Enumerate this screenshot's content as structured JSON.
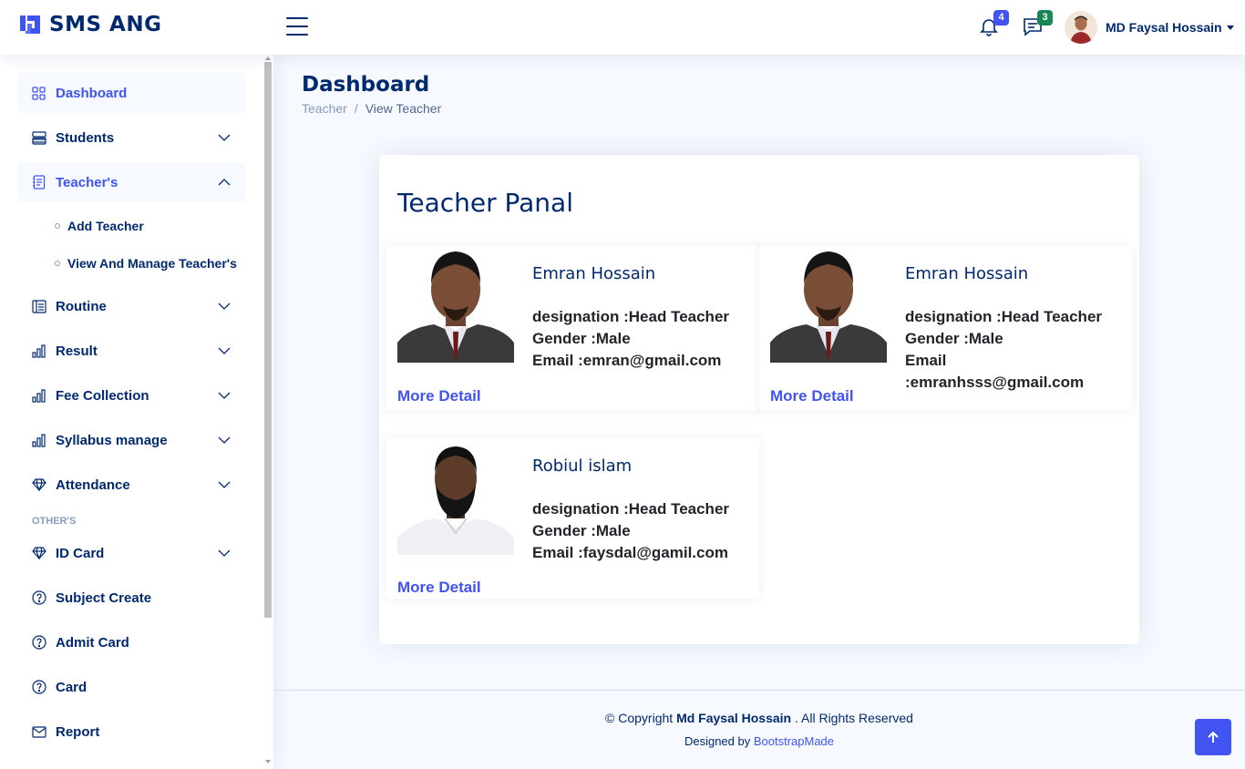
{
  "header": {
    "logo_text": "SMS ANG",
    "notifications_count": "4",
    "messages_count": "3",
    "profile_name": "MD Faysal Hossain"
  },
  "sidebar": {
    "items": [
      {
        "label": "Dashboard",
        "icon": "grid-icon"
      },
      {
        "label": "Students",
        "icon": "menu-button-icon"
      },
      {
        "label": "Teacher's",
        "icon": "journal-text-icon"
      },
      {
        "label": "Routine",
        "icon": "layout-text-icon"
      },
      {
        "label": "Result",
        "icon": "bar-chart-icon"
      },
      {
        "label": "Fee Collection",
        "icon": "bar-chart-icon"
      },
      {
        "label": "Syllabus manage",
        "icon": "bar-chart-icon"
      },
      {
        "label": "Attendance",
        "icon": "gem-icon"
      },
      {
        "label": "ID Card",
        "icon": "gem-icon"
      },
      {
        "label": "Subject Create",
        "icon": "question-circle-icon"
      },
      {
        "label": "Admit Card",
        "icon": "question-circle-icon"
      },
      {
        "label": "Card",
        "icon": "question-circle-icon"
      },
      {
        "label": "Report",
        "icon": "envelope-icon"
      }
    ],
    "sub_items": [
      "Add Teacher",
      "View And Manage Teacher's"
    ],
    "heading_others": "OTHER'S"
  },
  "page": {
    "title": "Dashboard",
    "breadcrumb": [
      "Teacher",
      "View Teacher"
    ]
  },
  "panel": {
    "title": "Teacher Panal",
    "more_label": "More Detail",
    "teachers": [
      {
        "name": "Emran Hossain",
        "designation": "designation :Head Teacher",
        "gender": "Gender :Male",
        "email": "Email :emran@gmail.com"
      },
      {
        "name": "Emran Hossain",
        "designation": "designation :Head Teacher",
        "gender": "Gender :Male",
        "email": "Email :emranhsss@gmail.com"
      },
      {
        "name": "Robiul islam",
        "designation": "designation :Head Teacher",
        "gender": "Gender :Male",
        "email": "Email :faysdal@gamil.com"
      }
    ]
  },
  "footer": {
    "copyright_prefix": "© Copyright ",
    "copyright_name": "Md Faysal Hossain",
    "copyright_suffix": " . All Rights Reserved",
    "designed_by": "Designed by ",
    "designer": "BootstrapMade"
  },
  "colors": {
    "primary": "#4154f1",
    "navy": "#012970",
    "background": "#f6f9ff"
  }
}
